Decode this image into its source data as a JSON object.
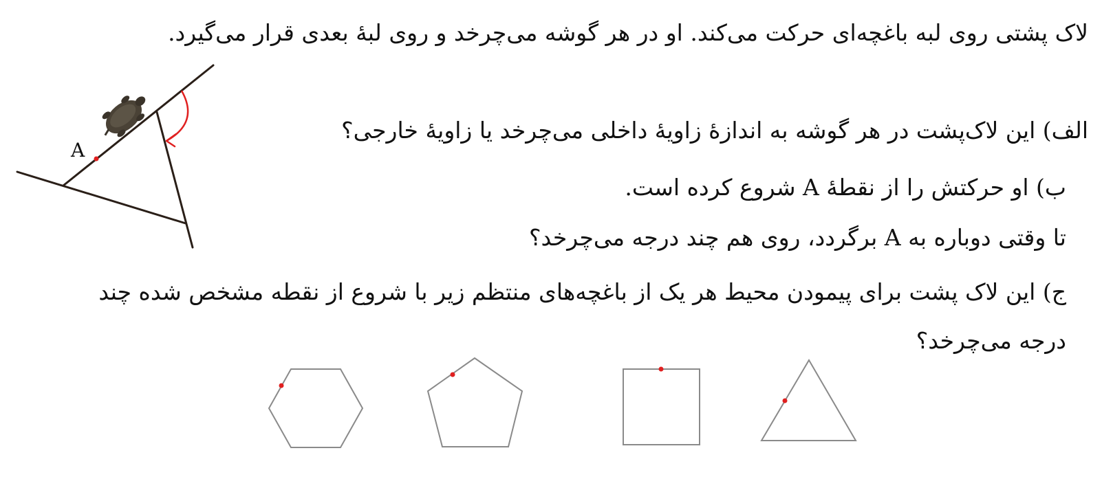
{
  "text": {
    "intro": "لاک پشتی روی لبه باغچه‌ای حرکت می‌کند. او در هر گوشه می‌چرخد و روی لبهٔ بعدی قرار می‌گیرد.",
    "q_alef": "الف) این لاک‌پشت در هر گوشه به اندازهٔ زاویهٔ داخلی می‌چرخد یا زاویهٔ خارجی؟",
    "q_be_1": "ب) او حرکتش را از نقطهٔ A شروع کرده است.",
    "q_be_2": "تا وقتی دوباره به A برگردد، روی هم چند درجه می‌چرخد؟",
    "q_jim_1": "ج) این لاک پشت برای پیمودن محیط هر یک از باغچه‌های منتظم زیر با شروع از نقطه مشخص شده چند",
    "q_jim_2": "درجه می‌چرخد؟"
  },
  "figure": {
    "point_label": "A",
    "turtle_icon": "turtle",
    "arrow_color": "#e02020",
    "line_color": "#2a1f18"
  },
  "shapes": [
    {
      "name": "triangle",
      "sides": 3
    },
    {
      "name": "square",
      "sides": 4
    },
    {
      "name": "pentagon",
      "sides": 5
    },
    {
      "name": "hexagon",
      "sides": 6
    }
  ],
  "colors": {
    "marker": "#e02020",
    "shape_stroke": "#8a8a8a"
  }
}
